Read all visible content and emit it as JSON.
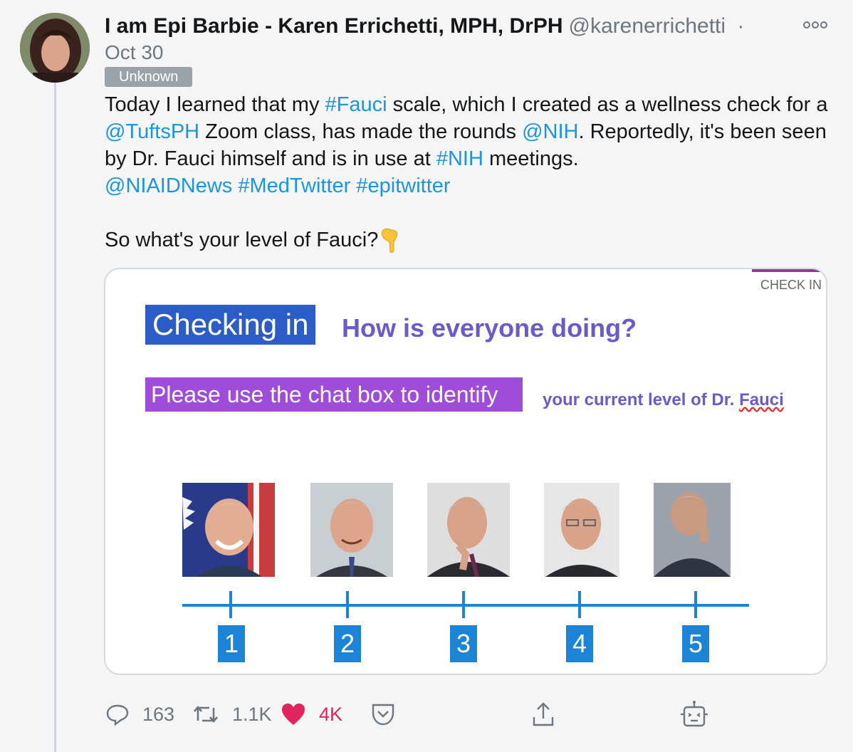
{
  "author": {
    "name": "I am Epi Barbie - Karen Errichetti, MPH, DrPH",
    "handle": "@karenerrichetti",
    "separator": "·",
    "date": "Oct 30",
    "badge": "Unknown"
  },
  "more_icon": "more-icon",
  "tweet": {
    "segments": [
      {
        "text": "Today I learned that my ",
        "link": false
      },
      {
        "text": "#Fauci",
        "link": true
      },
      {
        "text": " scale, which I created as a wellness check for a ",
        "link": false
      },
      {
        "text": "@TuftsPH",
        "link": true
      },
      {
        "text": " Zoom class, has made the rounds ",
        "link": false
      },
      {
        "text": "@NIH",
        "link": true
      },
      {
        "text": ". Reportedly, it's been seen by Dr. Fauci himself and is in use at ",
        "link": false
      },
      {
        "text": "#NIH",
        "link": true
      },
      {
        "text": " meetings.",
        "link": false
      }
    ],
    "hashtag_line": [
      "@NIAIDNews",
      "#MedTwitter",
      "#epitwitter"
    ],
    "closing": "So what's your level of Fauci?",
    "closing_emoji": "backhand-index-pointing-down"
  },
  "slide": {
    "corner_label": "CHECK IN",
    "title": "Checking in",
    "question": "How is everyone doing?",
    "instruction": "Please use the chat box to identify",
    "level_text_prefix": "your current level of Dr. ",
    "level_text_name": "Fauci",
    "scale": [
      "1",
      "2",
      "3",
      "4",
      "5"
    ],
    "colors": {
      "title_bg": "#2c5cc7",
      "instruction_bg": "#9e4cd9",
      "accent_text": "#6a5acd",
      "scale_line": "#1c84d6"
    }
  },
  "actions": {
    "reply": {
      "icon": "reply-icon",
      "count": "163"
    },
    "retweet": {
      "icon": "retweet-icon",
      "count": "1.1K"
    },
    "like": {
      "icon": "heart-icon",
      "count": "4K",
      "color": "#e0245e"
    },
    "save": {
      "icon": "pocket-icon"
    },
    "share": {
      "icon": "share-icon"
    },
    "bot": {
      "icon": "robot-icon"
    }
  }
}
